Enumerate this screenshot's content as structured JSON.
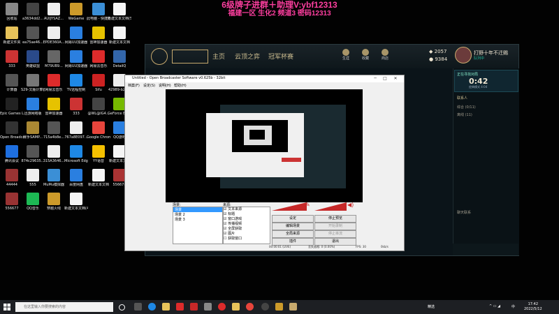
{
  "banner": {
    "line1": "6级牌子进群＋助理V:ybf12313",
    "line2": "福建一区 生化2 频道3 密码12313"
  },
  "desktop_icons": [
    {
      "label": "回收站",
      "color": "#888888"
    },
    {
      "label": "a3634dd2...",
      "color": "#444444"
    },
    {
      "label": "AUIJYSAZ...",
      "color": "#eeeeee"
    },
    {
      "label": "WeGame",
      "color": "#cc9a2a"
    },
    {
      "label": "此电脑 - 快捷方式",
      "color": "#3b8fd6"
    },
    {
      "label": "新建文本文档(5)",
      "color": "#f5f5f5"
    },
    {
      "label": "新建文件夹",
      "color": "#e8c35a"
    },
    {
      "label": "ea75ae46...",
      "color": "#555555"
    },
    {
      "label": "EPDE360A...",
      "color": "#eeeeee"
    },
    {
      "label": "网易UU加速器",
      "color": "#2a7fe0"
    },
    {
      "label": "雷神加速器",
      "color": "#e6c200"
    },
    {
      "label": "新建文本文档",
      "color": "#f5f5f5"
    },
    {
      "label": "333",
      "color": "#cc3333"
    },
    {
      "label": "英雄联盟",
      "color": "#2a4a8a"
    },
    {
      "label": "M79UB9...",
      "color": "#666666"
    },
    {
      "label": "网易UU加速器",
      "color": "#2a7fe0"
    },
    {
      "label": "网易云音乐",
      "color": "#dd2b2b"
    },
    {
      "label": "DetailQ",
      "color": "#3366aa"
    },
    {
      "label": "计算器",
      "color": "#555555"
    },
    {
      "label": "S29-文版计算器",
      "color": "#777777"
    },
    {
      "label": "网易云音乐",
      "color": "#dd2b2b"
    },
    {
      "label": "TV远程控制",
      "color": "#1e88e5"
    },
    {
      "label": "Sifu",
      "color": "#cc2222"
    },
    {
      "label": "42989-b26...",
      "color": "#eeeeee"
    },
    {
      "label": "Epic Games Launcher",
      "color": "#222222"
    },
    {
      "label": "迅游网络版",
      "color": "#2a7fe0"
    },
    {
      "label": "雷神加速器",
      "color": "#e6c200"
    },
    {
      "label": "333",
      "color": "#cc3333"
    },
    {
      "label": "@WL@IG4...",
      "color": "#444444"
    },
    {
      "label": "GeForce Experience",
      "color": "#76b900"
    },
    {
      "label": "Open Broadcast...",
      "color": "#333333"
    },
    {
      "label": "赛手SAMP...",
      "color": "#aa8833"
    },
    {
      "label": "715a4b8e...",
      "color": "#555555"
    },
    {
      "label": "767a8E097...",
      "color": "#eeeeee"
    },
    {
      "label": "Google Chrome",
      "color": "#e8453c"
    },
    {
      "label": "QQ游戏",
      "color": "#2a7fe0"
    },
    {
      "label": "腾讯会议",
      "color": "#1e6fe0"
    },
    {
      "label": "874c29635...",
      "color": "#555555"
    },
    {
      "label": "315A3646...",
      "color": "#eeeeee"
    },
    {
      "label": "Microsoft Edge",
      "color": "#1e88e5"
    },
    {
      "label": "YY语音",
      "color": "#f5c000"
    },
    {
      "label": "新建文本文档",
      "color": "#f5f5f5"
    },
    {
      "label": "44444",
      "color": "#993333"
    },
    {
      "label": "555",
      "color": "#eeeeee"
    },
    {
      "label": "MuMu模拟器",
      "color": "#3b8fd6"
    },
    {
      "label": "百度网盘",
      "color": "#2a7fe0"
    },
    {
      "label": "新建文本文档",
      "color": "#f5f5f5"
    },
    {
      "label": "556678",
      "color": "#aa3333"
    },
    {
      "label": "556677",
      "color": "#993333"
    },
    {
      "label": "QQ音乐",
      "color": "#1db954"
    },
    {
      "label": "穿越火线",
      "color": "#cc9a2a"
    },
    {
      "label": "新建文本文档(4)",
      "color": "#f5f5f5"
    }
  ],
  "lol": {
    "nav": [
      "主页",
      "云顶之弈",
      "冠军杯赛"
    ],
    "top_icons": [
      "生涯",
      "收藏",
      "商店"
    ],
    "currency_be": "2057",
    "currency_rp": "9384",
    "player_name": "打野十年不迁赐",
    "player_status": "队列中",
    "queue_label": "正在寻找对局",
    "queue_timer": "0:42",
    "queue_sub": "经典模式 4:04",
    "friends_title": "联系人",
    "friend_groups": [
      "综合 (0/11)",
      "离线 (11)"
    ],
    "chat_label": "聊天联系"
  },
  "obs": {
    "title": "Untitled - Open Broadcaster Software v0.625b - 32bit",
    "menu": [
      "档案(F)",
      "设定(S)",
      "说明(H)",
      "帮助(H)"
    ],
    "scenes_title": "场景:",
    "sources_title": "来源:",
    "scenes": [
      "场景",
      "场景 2",
      "场景 3"
    ],
    "sources": [
      "文本来源",
      "标题",
      "窗口游戏",
      "传播视频",
      "全屏获取",
      "图片",
      "获取窗口"
    ],
    "buttons": {
      "settings": "设定",
      "stop_preview": "停止预览",
      "edit_scene": "编辑场景",
      "start_record": "开始录制",
      "global_sources": "全局来源",
      "stop_stream": "停止串流",
      "plugins": "插件",
      "exit": "退出"
    },
    "status": [
      "00:00:01 (LIVE)",
      "丢失画格: 0 (0.00%)",
      "FPS: 30",
      "0kb/s"
    ]
  },
  "taskbar": {
    "search_placeholder": "在这里输入你要搜索的内容",
    "tray_text": "精选",
    "lang": "中",
    "time": "17:42",
    "date": "2022/5/12"
  }
}
